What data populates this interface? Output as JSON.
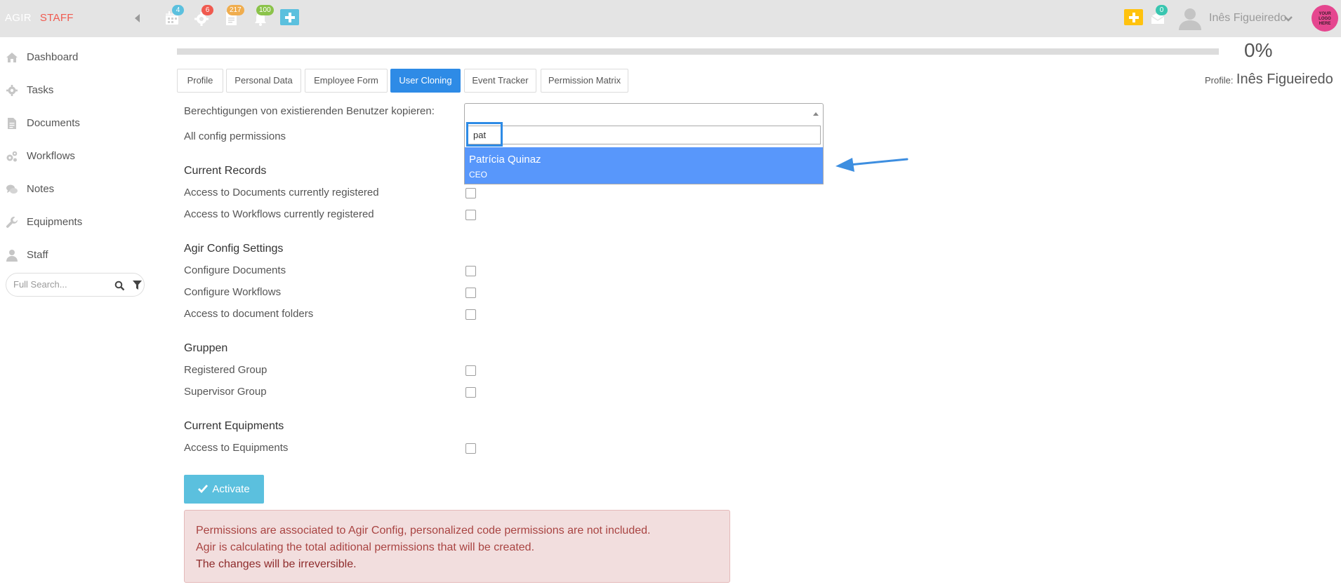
{
  "brand": {
    "part1": "AGIR",
    "part2": "STAFF"
  },
  "topbar": {
    "badges": {
      "calendar": "4",
      "settings": "6",
      "documents": "217",
      "notifications": "100",
      "messages": "0"
    },
    "user_name": "Inês Figueiredo",
    "logo_line1": "YOUR",
    "logo_line2": "LOGO",
    "logo_line3": "HERE",
    "colors": {
      "badge_blue": "#5bc0de",
      "badge_red": "#f05a4f",
      "badge_yellow": "#f0ad4e",
      "badge_green": "#8bc34a",
      "quick_add": "#5bc0de",
      "new_item": "#ffc20e",
      "messages_badge": "#39c6b0"
    }
  },
  "sidebar": {
    "items": [
      {
        "label": "Dashboard",
        "icon": "home-icon"
      },
      {
        "label": "Tasks",
        "icon": "gear-icon"
      },
      {
        "label": "Documents",
        "icon": "document-icon"
      },
      {
        "label": "Workflows",
        "icon": "gears-icon"
      },
      {
        "label": "Notes",
        "icon": "comments-icon"
      },
      {
        "label": "Equipments",
        "icon": "wrench-icon"
      },
      {
        "label": "Staff",
        "icon": "user-icon"
      }
    ],
    "search_placeholder": "Full Search..."
  },
  "progress": {
    "percent_label": "0%",
    "value": 0
  },
  "profile": {
    "label": "Profile:",
    "name": "Inês Figueiredo"
  },
  "tabs": [
    {
      "label": "Profile",
      "active": false
    },
    {
      "label": "Personal Data",
      "active": false
    },
    {
      "label": "Employee Form",
      "active": false
    },
    {
      "label": "User Cloning",
      "active": true
    },
    {
      "label": "Event Tracker",
      "active": false
    },
    {
      "label": "Permission Matrix",
      "active": false
    }
  ],
  "form": {
    "copy_label": "Berechtigungen von existierenden Benutzer kopieren:",
    "all_config_label": "All config permissions",
    "select": {
      "search_value": "pat",
      "option_name": "Patrícia Quinaz",
      "option_role": "CEO"
    },
    "sections": [
      {
        "title": "Current Records",
        "rows": [
          "Access to Documents currently registered",
          "Access to Workflows currently registered"
        ]
      },
      {
        "title": "Agir Config Settings",
        "rows": [
          "Configure Documents",
          "Configure Workflows",
          "Access to document folders"
        ]
      },
      {
        "title": "Gruppen",
        "rows": [
          "Registered Group",
          "Supervisor Group"
        ]
      },
      {
        "title": "Current Equipments",
        "rows": [
          "Access to Equipments"
        ]
      }
    ],
    "activate_label": "Activate"
  },
  "alert": {
    "line1": "Permissions are associated to Agir Config, personalized code permissions are not included.",
    "line2": "Agir is calculating the total aditional permissions that will be created.",
    "line3": "The changes will be irreversible."
  }
}
